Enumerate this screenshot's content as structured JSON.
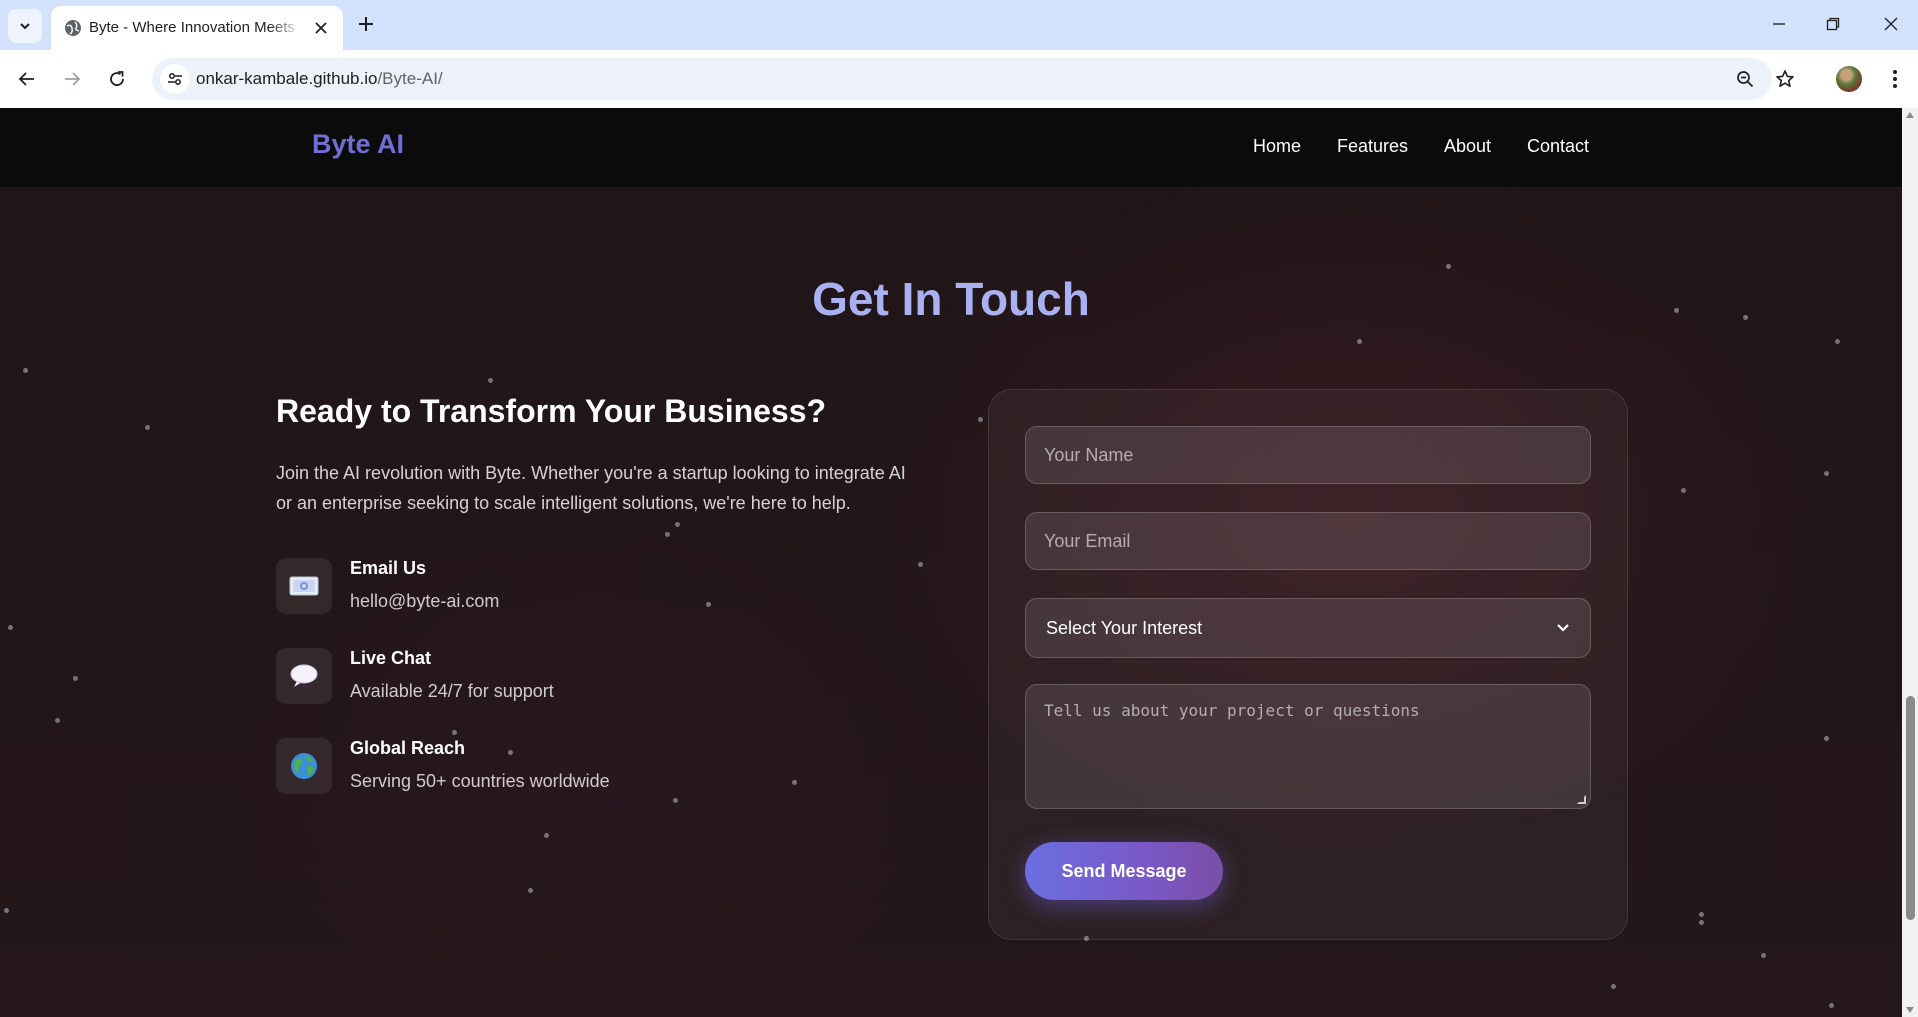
{
  "browser": {
    "tab_title": "Byte - Where Innovation Meets",
    "url_host": "onkar-kambale.github.io",
    "url_path": "/Byte-AI/"
  },
  "site": {
    "brand": "Byte AI",
    "nav": [
      "Home",
      "Features",
      "About",
      "Contact"
    ]
  },
  "contact": {
    "section_title": "Get In Touch",
    "heading": "Ready to Transform Your Business?",
    "description": "Join the AI revolution with Byte. Whether you're a startup looking to integrate AI or an enterprise seeking to scale intelligent solutions, we're here to help.",
    "items": [
      {
        "title": "Email Us",
        "value": "hello@byte-ai.com",
        "icon": "email-icon"
      },
      {
        "title": "Live Chat",
        "value": "Available 24/7 for support",
        "icon": "chat-bubble-icon"
      },
      {
        "title": "Global Reach",
        "value": "Serving 50+ countries worldwide",
        "icon": "globe-icon"
      }
    ]
  },
  "form": {
    "name_placeholder": "Your Name",
    "email_placeholder": "Your Email",
    "interest_selected": "Select Your Interest",
    "message_placeholder": "Tell us about your project or questions",
    "submit_label": "Send Message"
  },
  "colors": {
    "brand": "#6f6fd6",
    "title": "#a9b1f0",
    "button_start": "#6a6fe0",
    "button_end": "#7b4fa8"
  }
}
